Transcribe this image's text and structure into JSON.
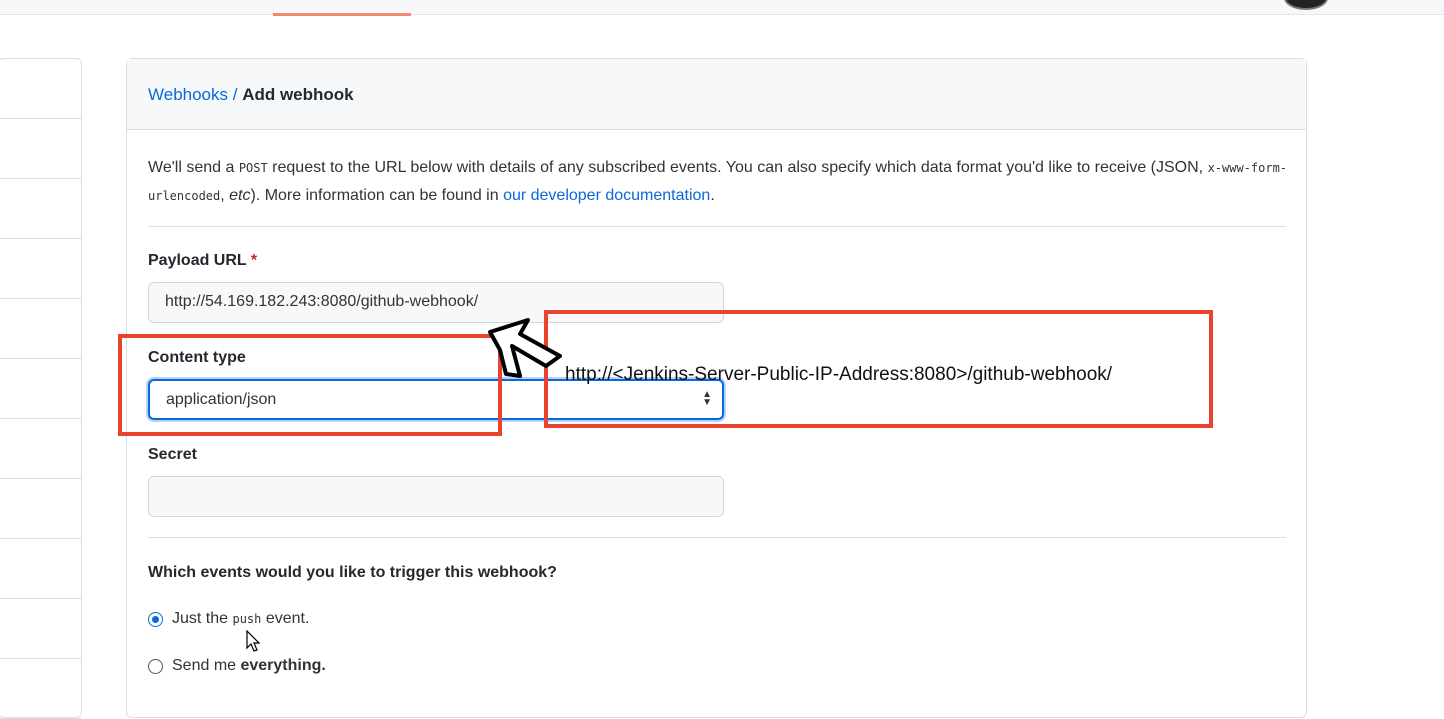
{
  "breadcrumb": {
    "parent": "Webhooks",
    "separator": " / ",
    "current": "Add webhook"
  },
  "description": {
    "part1": "We'll send a ",
    "post": "POST",
    "part2": " request to the URL below with details of any subscribed events. You can also specify which data format you'd like to receive (JSON, ",
    "format": "x-www-form-urlencoded",
    "part3": ", ",
    "etc": "etc",
    "part4": "). More information can be found in ",
    "link": "our developer documentation",
    "part5": "."
  },
  "payload_url": {
    "label": "Payload URL",
    "required": "*",
    "value": "http://54.169.182.243:8080/github-webhook/"
  },
  "content_type": {
    "label": "Content type",
    "value": "application/json"
  },
  "secret": {
    "label": "Secret",
    "value": ""
  },
  "events": {
    "question": "Which events would you like to trigger this webhook?",
    "opt1_a": "Just the ",
    "opt1_code": "push",
    "opt1_b": " event.",
    "opt2_a": "Send me ",
    "opt2_b": "everything."
  },
  "annotation": {
    "text": "http://<Jenkins-Server-Public-IP-Address:8080>/github-webhook/",
    "color": "#e8432e"
  }
}
